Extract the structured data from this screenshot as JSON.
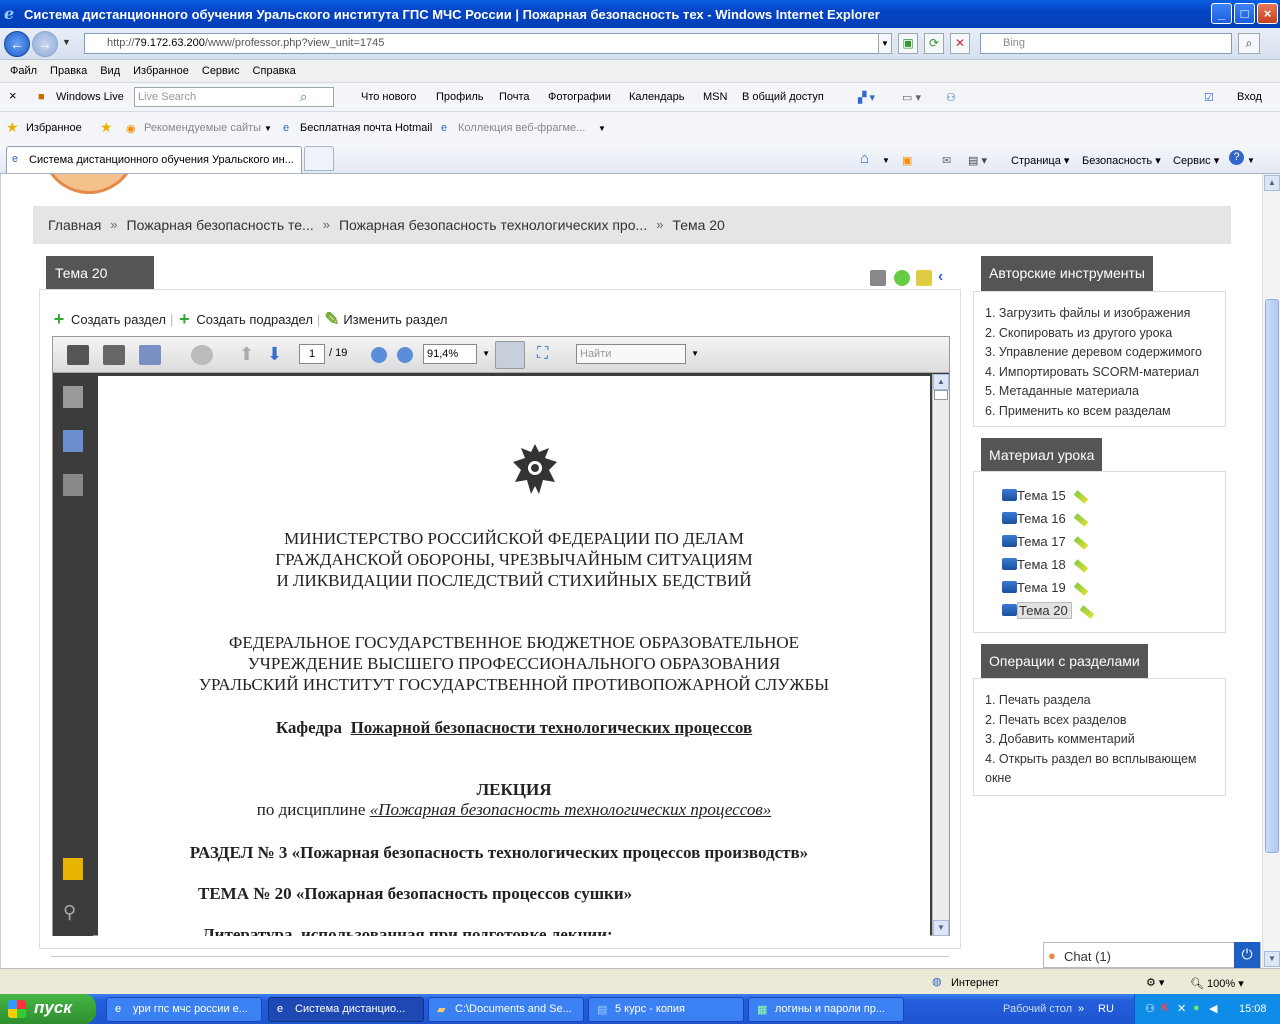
{
  "window": {
    "title": "Система дистанционного обучения Уральского института ГПС МЧС России | Пожарная безопасность тех - Windows Internet Explorer"
  },
  "address_bar": {
    "url_prefix": "http://",
    "url_host": "79.172.63.200",
    "url_path": "/www/professor.php?view_unit=1745",
    "search_placeholder": "Bing"
  },
  "menu": [
    "Файл",
    "Правка",
    "Вид",
    "Избранное",
    "Сервис",
    "Справка"
  ],
  "live_toolbar": {
    "brand": "Windows Live",
    "search_placeholder": "Live Search",
    "links": [
      "Что нового",
      "Профиль",
      "Почта",
      "Фотографии",
      "Календарь",
      "MSN",
      "В общий доступ"
    ],
    "signin": "Вход"
  },
  "favorites_bar": {
    "favorites_label": "Избранное",
    "items": [
      "Рекомендуемые сайты",
      "Бесплатная почта Hotmail",
      "Коллекция веб-фрагме..."
    ]
  },
  "tabs": {
    "active_tab": "Система дистанционного обучения Уральского ин...",
    "commands": [
      "Страница",
      "Безопасность",
      "Сервис"
    ]
  },
  "breadcrumb": [
    "Главная",
    "Пожарная безопасность те...",
    "Пожарная безопасность технологических про...",
    "Тема 20"
  ],
  "lesson": {
    "tab_title": "Тема 20",
    "actions": [
      "Создать раздел",
      "Создать подраздел",
      "Изменить раздел"
    ]
  },
  "pdf_viewer": {
    "page_current": "1",
    "page_total": "/ 19",
    "zoom": "91,4%",
    "find_placeholder": "Найти"
  },
  "document": {
    "ministry": [
      "МИНИСТЕРСТВО РОССИЙСКОЙ ФЕДЕРАЦИИ ПО ДЕЛАМ",
      "ГРАЖДАНСКОЙ ОБОРОНЫ, ЧРЕЗВЫЧАЙНЫМ СИТУАЦИЯМ",
      "И ЛИКВИДАЦИИ ПОСЛЕДСТВИЙ СТИХИЙНЫХ БЕДСТВИЙ"
    ],
    "institution": [
      "ФЕДЕРАЛЬНОЕ ГОСУДАРСТВЕННОЕ БЮДЖЕТНОЕ ОБРАЗОВАТЕЛЬНОЕ",
      "УЧРЕЖДЕНИЕ ВЫСШЕГО ПРОФЕССИОНАЛЬНОГО ОБРАЗОВАНИЯ",
      "УРАЛЬСКИЙ ИНСТИТУТ ГОСУДАРСТВЕННОЙ ПРОТИВОПОЖАРНОЙ СЛУЖБЫ"
    ],
    "chair_label": "Кафедра",
    "chair_name": "Пожарной безопасности технологических процессов",
    "lecture": "ЛЕКЦИЯ",
    "discipline_label": "по дисциплине",
    "discipline_name": "«Пожарная безопасность технологических процессов»",
    "section": "РАЗДЕЛ № 3 «Пожарная безопасность технологических процессов производств»",
    "topic": "ТЕМА № 20  «Пожарная безопасность процессов сушки»",
    "literature": "Литература, использованная при подготовке лекции:"
  },
  "author_tools": {
    "title": "Авторские инструменты",
    "items": [
      "1. Загрузить файлы и изображения",
      "2. Скопировать из другого урока",
      "3. Управление деревом содержимого",
      "4. Импортировать SCORM-материал",
      "5. Метаданные материала",
      "6. Применить ко всем разделам"
    ]
  },
  "lesson_material": {
    "title": "Материал урока",
    "items": [
      "Тема 15",
      "Тема 16",
      "Тема 17",
      "Тема 18",
      "Тема 19",
      "Тема 20"
    ],
    "selected": "Тема 20"
  },
  "section_ops": {
    "title": "Операции с разделами",
    "items": [
      "1. Печать раздела",
      "2. Печать всех разделов",
      "3. Добавить комментарий",
      "4. Открыть раздел во всплывающем окне"
    ]
  },
  "chat": {
    "label": "Chat (1)"
  },
  "statusbar": {
    "zone": "Интернет",
    "zoom": "100%"
  },
  "taskbar": {
    "start": "пуск",
    "tasks": [
      "ури гпс мчс россии е...",
      "Система дистанцио...",
      "C:\\Documents and Se...",
      "5 курс - копия",
      "логины и пароли пр..."
    ],
    "desktop_label": "Рабочий стол",
    "lang": "RU",
    "clock": "15:08"
  },
  "colors": {
    "panel_header": "#555555",
    "breadcrumb_bg": "#e5e5e5",
    "taskbar": "#245edc",
    "titlebar": "#0444c4"
  }
}
